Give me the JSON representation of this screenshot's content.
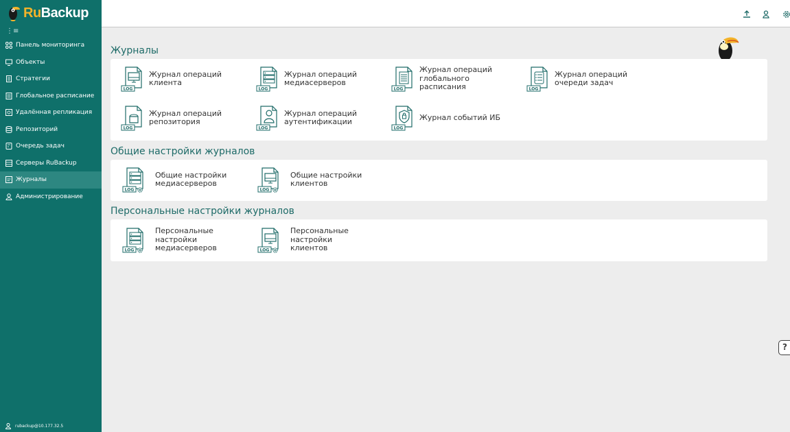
{
  "brand": {
    "ru": "Ru",
    "backup": "Backup"
  },
  "sidebar": {
    "collapse_glyph": "⋮≡",
    "items": [
      {
        "label": "Панель мониторинга",
        "icon": "dashboard-icon"
      },
      {
        "label": "Объекты",
        "icon": "monitor-icon"
      },
      {
        "label": "Стратегии",
        "icon": "document-icon"
      },
      {
        "label": "Глобальное расписание",
        "icon": "calendar-icon"
      },
      {
        "label": "Удалённая репликация",
        "icon": "replication-icon"
      },
      {
        "label": "Репозиторий",
        "icon": "database-icon"
      },
      {
        "label": "Очередь задач",
        "icon": "queue-icon"
      },
      {
        "label": "Серверы RuBackup",
        "icon": "server-icon"
      },
      {
        "label": "Журналы",
        "icon": "log-icon",
        "active": true
      },
      {
        "label": "Администрирование",
        "icon": "user-icon"
      }
    ],
    "user": "rubackup@10.177.32.5"
  },
  "topbar": {
    "icons": [
      "upload-icon",
      "user-icon",
      "settings-icon"
    ]
  },
  "sections": {
    "logs": {
      "title": "Журналы",
      "tiles": [
        {
          "label": "Журнал операций\nклиента",
          "icon": "client-log-icon"
        },
        {
          "label": "Журнал операций\nмедиасерверов",
          "icon": "mediaserver-log-icon"
        },
        {
          "label": "Журнал операций\nглобального\nрасписания",
          "icon": "schedule-log-icon"
        },
        {
          "label": "Журнал операций\nочереди задач",
          "icon": "queue-log-icon"
        },
        {
          "label": "Журнал операций\nрепозитория",
          "icon": "repository-log-icon"
        },
        {
          "label": "Журнал операций\nаутентификации",
          "icon": "auth-log-icon"
        },
        {
          "label": "Журнал событий ИБ",
          "icon": "security-log-icon"
        }
      ]
    },
    "general_settings": {
      "title": "Общие настройки журналов",
      "tiles": [
        {
          "label": "Общие настройки\nмедиасерверов",
          "icon": "mediaserver-settings-icon"
        },
        {
          "label": "Общие настройки\nклиентов",
          "icon": "client-settings-icon"
        }
      ]
    },
    "personal_settings": {
      "title": "Персональные настройки журналов",
      "tiles": [
        {
          "label": "Персональные\nнастройки\nмедиасерверов",
          "icon": "mediaserver-personal-settings-icon"
        },
        {
          "label": "Персональные\nнастройки\nклиентов",
          "icon": "client-personal-settings-icon"
        }
      ]
    }
  },
  "log_tag": "LOG",
  "help_label": "?",
  "colors": {
    "sidebar": "#0f706a",
    "sidebar_active": "#2d8781",
    "accent": "#1e6b68",
    "logo_ru": "#f3b32a"
  }
}
